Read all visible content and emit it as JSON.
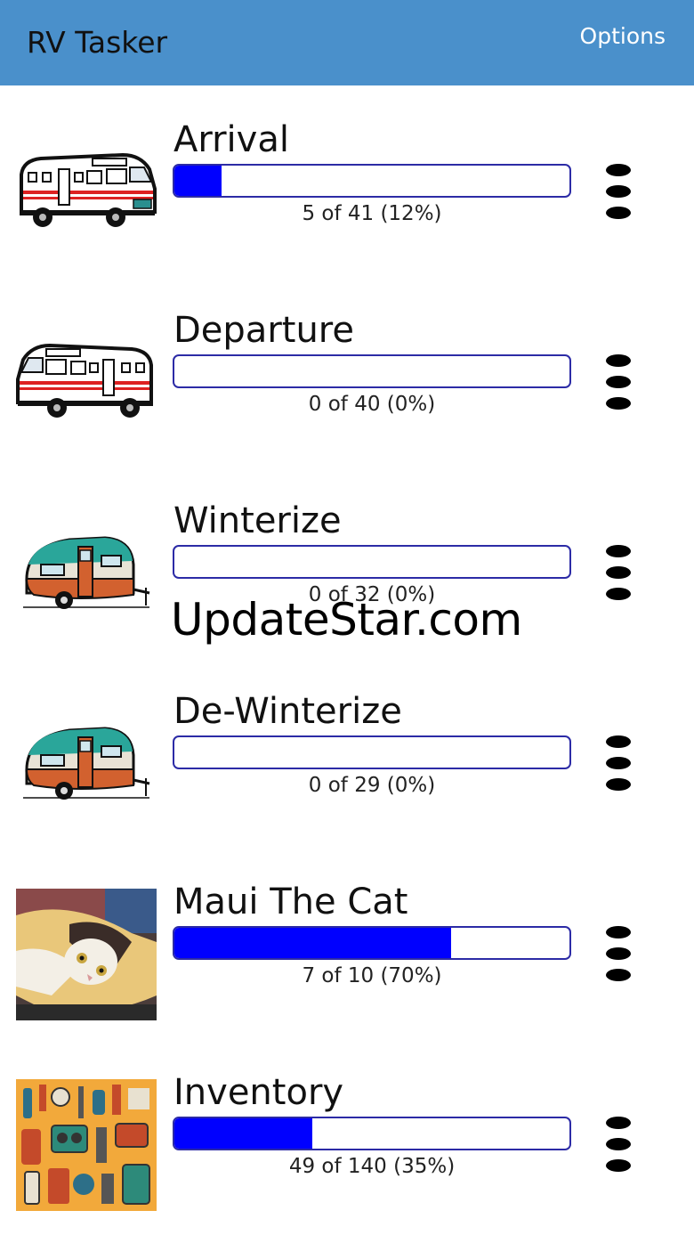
{
  "app": {
    "title": "RV Tasker",
    "options_label": "Options"
  },
  "tasks": [
    {
      "name": "Arrival",
      "done": 5,
      "total": 41,
      "progress": 0.12,
      "count_text": "5 of 41 (12%)",
      "image": "motorhome"
    },
    {
      "name": "Departure",
      "done": 0,
      "total": 40,
      "progress": 0.0,
      "count_text": "0 of 40 (0%)",
      "image": "motorhome"
    },
    {
      "name": "Winterize",
      "done": 0,
      "total": 32,
      "progress": 0.0,
      "count_text": "0 of 32 (0%)",
      "image": "vintage-trailer"
    },
    {
      "name": "De-Winterize",
      "done": 0,
      "total": 29,
      "progress": 0.0,
      "count_text": "0 of 29 (0%)",
      "image": "vintage-trailer"
    },
    {
      "name": "Maui The Cat",
      "done": 7,
      "total": 10,
      "progress": 0.7,
      "count_text": "7 of 10 (70%)",
      "image": "cat-photo"
    },
    {
      "name": "Inventory",
      "done": 49,
      "total": 140,
      "progress": 0.35,
      "count_text": "49 of 140 (35%)",
      "image": "camping-gear"
    }
  ],
  "watermark": "UpdateStar.com",
  "colors": {
    "appbar": "#4a90cb",
    "progress_fill": "#0000ff",
    "progress_border": "#2c2ba6"
  },
  "icons": {
    "row_menu": "more-vert-icon"
  }
}
